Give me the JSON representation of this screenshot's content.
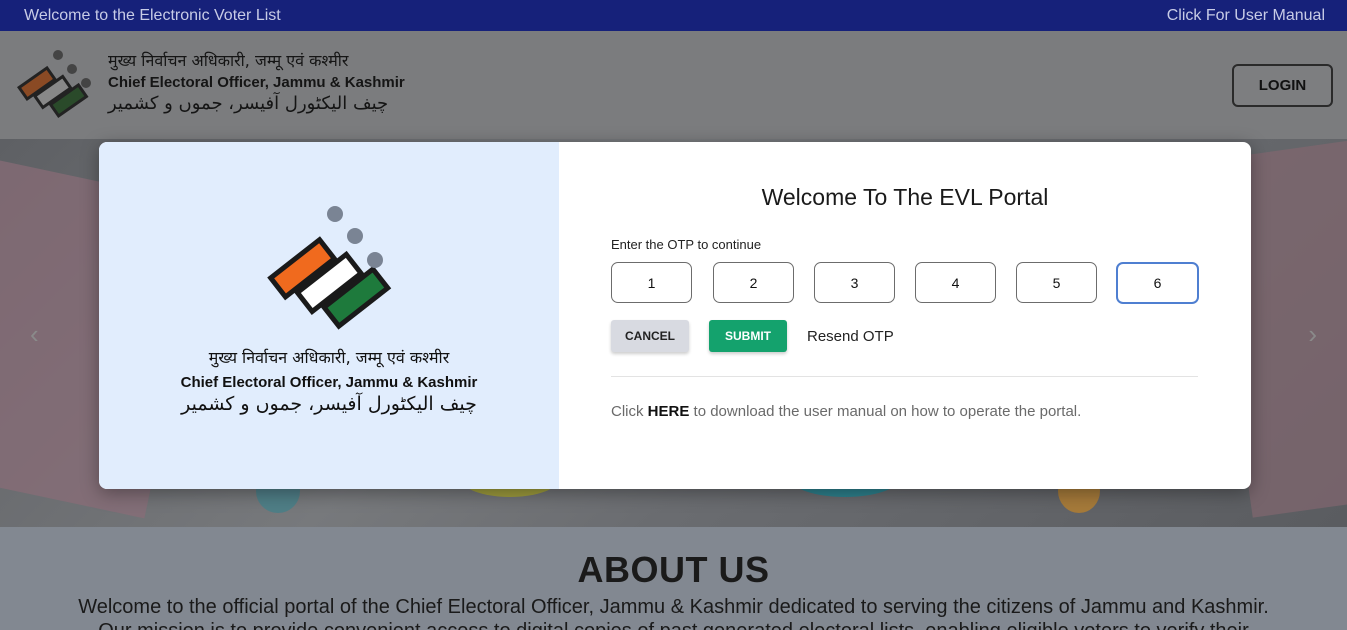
{
  "topbar": {
    "welcome": "Welcome to the Electronic Voter List",
    "manual_link": "Click For User Manual"
  },
  "header": {
    "title_hindi": "मुख्य निर्वाचन अधिकारी, जम्मू एवं कश्मीर",
    "title_english": "Chief Electoral Officer, Jammu & Kashmir",
    "title_urdu": "چیف الیکٹورل آفیسر، جموں و کشمیر",
    "login_label": "LOGIN"
  },
  "about": {
    "heading": "ABOUT US",
    "text": "Welcome to the official portal of the Chief Electoral Officer, Jammu & Kashmir dedicated to serving the citizens of Jammu and Kashmir. Our mission is to provide convenient access to digital copies of past generated electoral lists, enabling eligible voters to verify their"
  },
  "modal": {
    "left": {
      "title_hindi": "मुख्य निर्वाचन अधिकारी, जम्मू एवं कश्मीर",
      "title_english": "Chief Electoral Officer, Jammu & Kashmir",
      "title_urdu": "چیف الیکٹورل آفیسر، جموں و کشمیر"
    },
    "title": "Welcome To The EVL Portal",
    "otp_label": "Enter the OTP to continue",
    "otp_digits": [
      "1",
      "2",
      "3",
      "4",
      "5",
      "6"
    ],
    "cancel_label": "CANCEL",
    "submit_label": "SUBMIT",
    "resend_label": "Resend OTP",
    "manual_prefix": "Click",
    "manual_here": "HERE",
    "manual_suffix": "to download the user manual on how to operate the portal."
  },
  "colors": {
    "topbar": "#16217a",
    "submit": "#14a26d",
    "modal_left_bg": "#e1edfd",
    "otp_active_border": "#4f7fd1"
  }
}
